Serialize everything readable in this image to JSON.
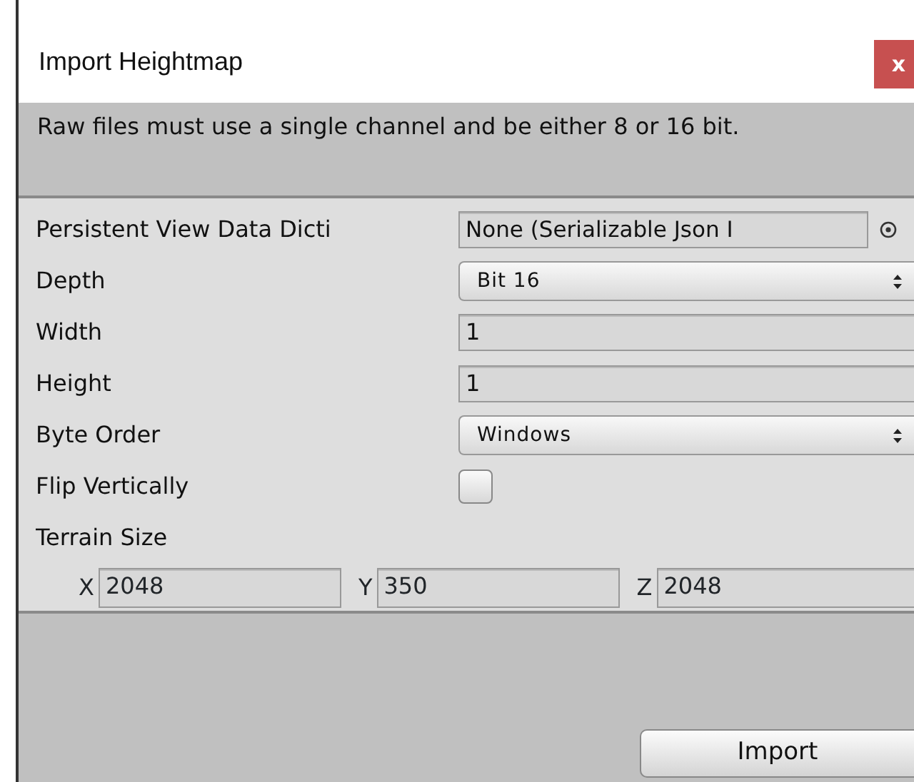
{
  "window": {
    "title": "Import Heightmap",
    "close": "x"
  },
  "message": "Raw files must use a single channel and be either 8 or 16 bit.",
  "fields": [
    {
      "kind": "object",
      "label": "Persistent View Data Dicti",
      "value": "None (Serializable Json I"
    },
    {
      "kind": "popup",
      "label": "Depth",
      "value": "Bit 16"
    },
    {
      "kind": "text",
      "label": "Width",
      "value": "1"
    },
    {
      "kind": "text",
      "label": "Height",
      "value": "1"
    },
    {
      "kind": "popup",
      "label": "Byte Order",
      "value": "Windows"
    },
    {
      "kind": "checkbox",
      "label": "Flip Vertically",
      "checked": false
    },
    {
      "kind": "vector",
      "label": "Terrain Size",
      "components": [
        {
          "axis": "X",
          "value": "2048"
        },
        {
          "axis": "Y",
          "value": "350"
        },
        {
          "axis": "Z",
          "value": "2048"
        }
      ]
    }
  ],
  "buttons": [
    "Import"
  ]
}
